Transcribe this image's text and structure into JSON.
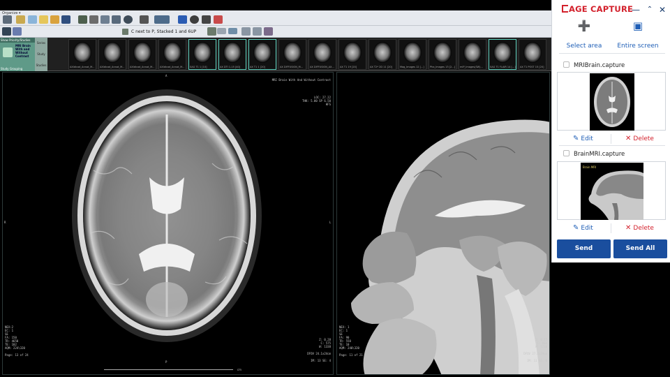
{
  "app": {
    "menu_label": "Organize ▾",
    "layout_field": "C next to P, Stacked 1 and 6UP"
  },
  "thumbnails": [
    {
      "label": "AXIdicad_Annot_M...",
      "selected": false
    },
    {
      "label": "AXIdicad_Annot_M...",
      "selected": false
    },
    {
      "label": "AXIdicad_Annot_M...",
      "selected": false
    },
    {
      "label": "AXIdicad_Annot_M...",
      "selected": false
    },
    {
      "label": "SAG T1 1 [10]",
      "selected": true
    },
    {
      "label": "AX DTI 1-15 [40]",
      "selected": true
    },
    {
      "label": "AX T1 1 [20]",
      "selected": true
    },
    {
      "label": "AX DIFFUSION_M...",
      "selected": false
    },
    {
      "label": "AX DIFFUSION_AX...",
      "selected": false
    },
    {
      "label": "AX T1 19 [20]",
      "selected": false
    },
    {
      "label": "AX T2* 2D 11 [20]",
      "selected": false
    },
    {
      "label": "Mag_Images 12 [...]",
      "selected": false
    },
    {
      "label": "Pha_Images 13 [2...]",
      "selected": false
    },
    {
      "label": "mIP_Images(SW)...",
      "selected": false
    },
    {
      "label": "SAG T1 FLAIR 14 [...]",
      "selected": true
    },
    {
      "label": "AX T1 POST 15 [20]",
      "selected": false
    }
  ],
  "study": {
    "header": "Show Priority/Studies",
    "thumb_text": "MRI Brain With and Without Contrast",
    "grouping": "Study Grouping",
    "tabs": [
      "Series",
      "Study",
      "Studies"
    ]
  },
  "left_viewport": {
    "top_marker": "A",
    "left_marker": "R",
    "right_marker": "L",
    "bottom_marker": "P",
    "top_right": "MRI Brain With And Without Contrast\n\n\n\n\nLOC: 27.22\nTHK: 5.00 SP 6.50\nHFS",
    "bottom_left": "NEX:2\nEC: 1\nSE\nFA: 150\nTR: 4650\nTE: 102\nAQM: 224\\320\n\nPage: 13 of 24",
    "bottom_right": "Z: 0.28\nC: 575\nW: 1338\n\nDFOV 24.1x24cm\n\nIM: 13 SE: 4",
    "scale_unit": "cm"
  },
  "right_viewport": {
    "bottom_left": "NEX: 1\nEC: 1\nSE\nFA: 90\nTR: 550\nTE: 10\nAQM: 240\\320\n\nPage: 11 of 21",
    "bottom_right": "Z: 0.25\nC: 608\nW: 1216\n\nDFOV 27.2x24cm\n\nIM: 11 SE: 6"
  },
  "capture_panel": {
    "title": "AGE CAPTURE",
    "minimize_icon": "minimize-icon",
    "collapse_icon": "chevron-double-up-icon",
    "close_icon": "close-icon",
    "modes": [
      {
        "label": "Select area",
        "icon": "crosshair-icon"
      },
      {
        "label": "Entire screen",
        "icon": "fullscreen-icon"
      }
    ],
    "items": [
      {
        "name": "MRIBrain.capture",
        "edit": "Edit",
        "delete": "Delete"
      },
      {
        "name": "BrainMRI.capture",
        "edit": "Edit",
        "delete": "Delete"
      }
    ],
    "send_label": "Send",
    "send_all_label": "Send All",
    "accent_color": "#1a4e9e",
    "brand_color": "#d3212c"
  }
}
